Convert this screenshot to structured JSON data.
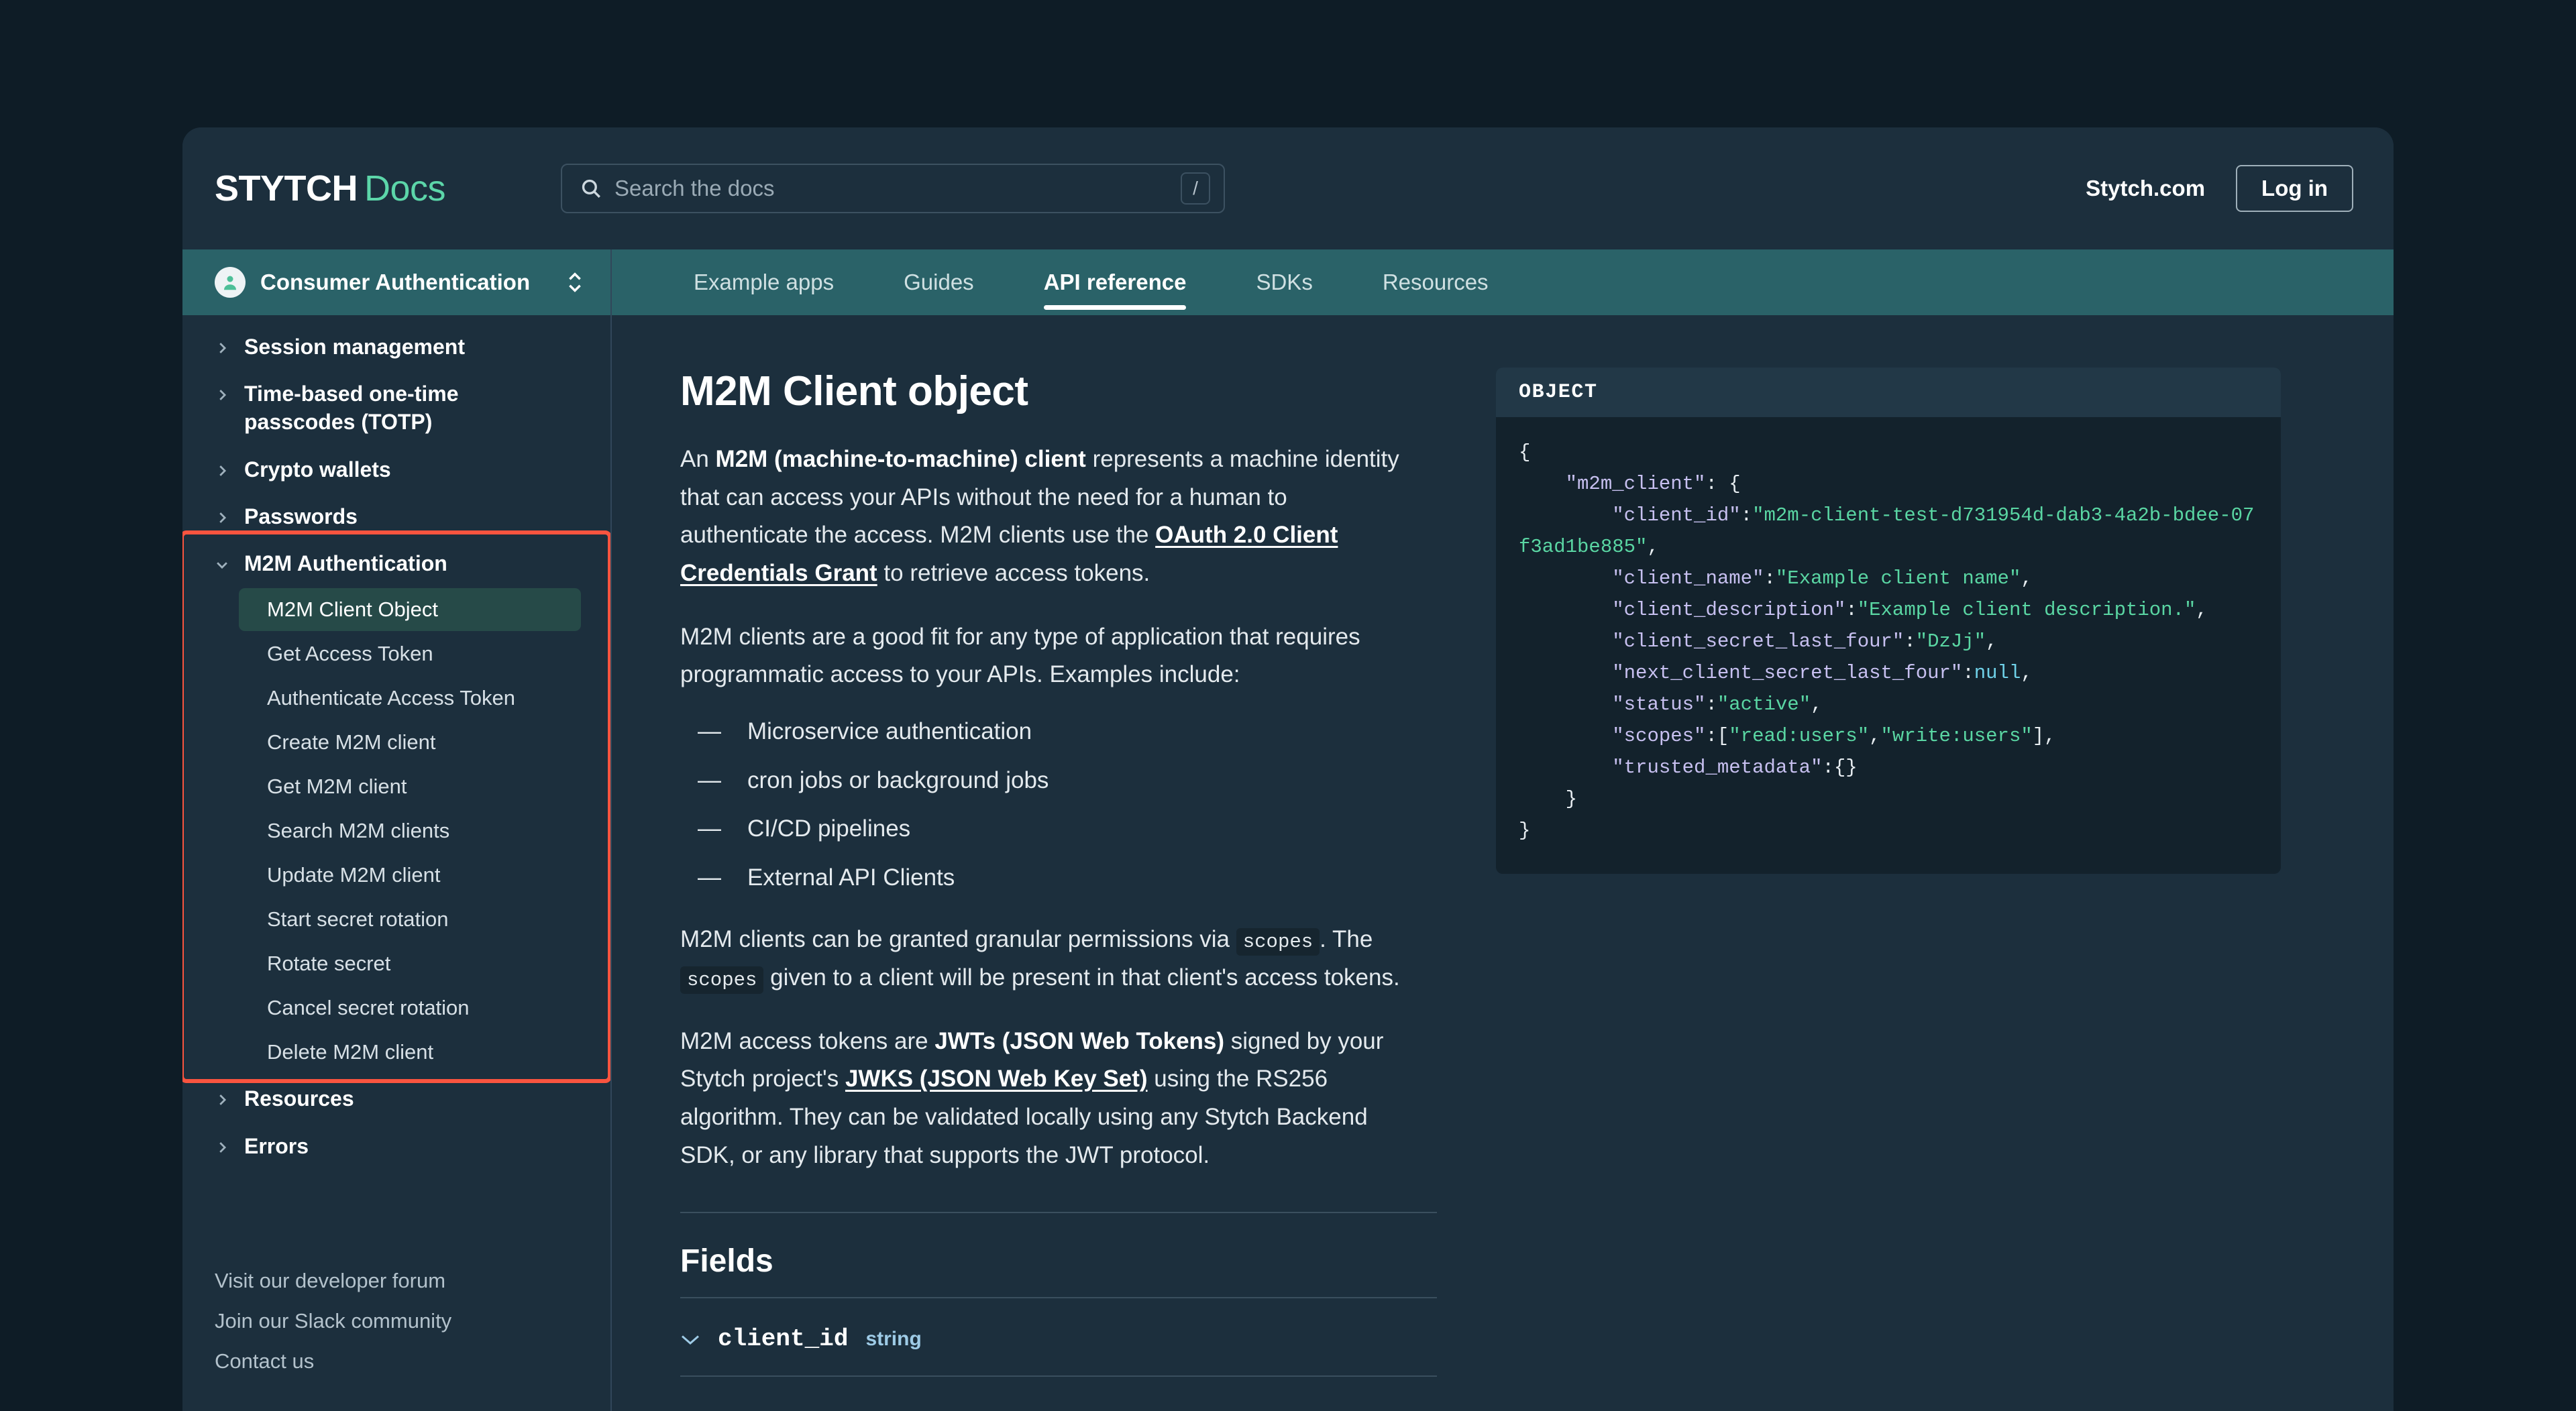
{
  "header": {
    "logo_primary": "STYTCH",
    "logo_secondary": "Docs",
    "stytch_com_link": "Stytch.com",
    "login_button": "Log in"
  },
  "search": {
    "placeholder": "Search the docs",
    "shortcut_key": "/"
  },
  "sidebar": {
    "product_selector": "Consumer Authentication",
    "groups": [
      {
        "label": "Session management",
        "expanded": false
      },
      {
        "label": "Time-based one-time passcodes (TOTP)",
        "expanded": false
      },
      {
        "label": "Crypto wallets",
        "expanded": false
      },
      {
        "label": "Passwords",
        "expanded": false
      },
      {
        "label": "M2M Authentication",
        "expanded": true
      },
      {
        "label": "Resources",
        "expanded": false
      },
      {
        "label": "Errors",
        "expanded": false
      }
    ],
    "m2m_items": [
      {
        "label": "M2M Client Object",
        "active": true
      },
      {
        "label": "Get Access Token",
        "active": false
      },
      {
        "label": "Authenticate Access Token",
        "active": false
      },
      {
        "label": "Create M2M client",
        "active": false
      },
      {
        "label": "Get M2M client",
        "active": false
      },
      {
        "label": "Search M2M clients",
        "active": false
      },
      {
        "label": "Update M2M client",
        "active": false
      },
      {
        "label": "Start secret rotation",
        "active": false
      },
      {
        "label": "Rotate secret",
        "active": false
      },
      {
        "label": "Cancel secret rotation",
        "active": false
      },
      {
        "label": "Delete M2M client",
        "active": false
      }
    ],
    "footer_links": [
      "Visit our developer forum",
      "Join our Slack community",
      "Contact us"
    ]
  },
  "tabs": [
    {
      "label": "Example apps",
      "active": false
    },
    {
      "label": "Guides",
      "active": false
    },
    {
      "label": "API reference",
      "active": true
    },
    {
      "label": "SDKs",
      "active": false
    },
    {
      "label": "Resources",
      "active": false
    }
  ],
  "main": {
    "page_title": "M2M Client object",
    "paragraph1": {
      "lead": "An ",
      "bold1": "M2M (machine-to-machine) client",
      "mid": " represents a machine identity that can access your APIs without the need for a human to authenticate the access. M2M clients use the ",
      "link1": "OAuth 2.0 Client Credentials Grant",
      "tail": " to retrieve access tokens."
    },
    "paragraph2": "M2M clients are a good fit for any type of application that requires programmatic access to your APIs. Examples include:",
    "bullets": [
      "Microservice authentication",
      "cron jobs or background jobs",
      "CI/CD pipelines",
      "External API Clients"
    ],
    "bullet_marker": "—",
    "paragraph3": {
      "part1": "M2M clients can be granted granular permissions via ",
      "code1": "scopes",
      "part2": ". The ",
      "code2": "scopes",
      "part3": " given to a client will be present in that client's access tokens."
    },
    "paragraph4": {
      "part1": "M2M access tokens are ",
      "bold1": "JWTs (JSON Web Tokens)",
      "part2": " signed by your Stytch project's ",
      "link1": "JWKS (JSON Web Key Set)",
      "part3": " using the RS256 algorithm. They can be validated locally using any Stytch Backend SDK, or any library that supports the JWT protocol."
    },
    "fields_title": "Fields",
    "fields": [
      {
        "name": "client_id",
        "type": "string"
      }
    ]
  },
  "code_panel": {
    "header": "OBJECT",
    "lines": [
      {
        "text": "{",
        "cls": "p"
      },
      {
        "text": "    \"m2m_client\": {",
        "cls": "k"
      },
      {
        "text": "        \"client_id\":\"m2m-client-test-d731954d-dab3-4a2b-bdee-07f3ad1be885\",",
        "cls": "mix"
      },
      {
        "text": "        \"client_name\":\"Example client name\",",
        "cls": "mix"
      },
      {
        "text": "        \"client_description\":\"Example client description.\",",
        "cls": "mix"
      },
      {
        "text": "        \"client_secret_last_four\":\"DzJj\",",
        "cls": "mix"
      },
      {
        "text": "        \"next_client_secret_last_four\":null,",
        "cls": "mix"
      },
      {
        "text": "        \"status\":\"active\",",
        "cls": "mix"
      },
      {
        "text": "        \"scopes\":[\"read:users\",\"write:users\"],",
        "cls": "mix"
      },
      {
        "text": "        \"trusted_metadata\":{}",
        "cls": "mix"
      },
      {
        "text": "    }",
        "cls": "p"
      },
      {
        "text": "}",
        "cls": "p"
      }
    ],
    "json": {
      "m2m_client": {
        "client_id": "m2m-client-test-d731954d-dab3-4a2b-bdee-07f3ad1be885",
        "client_name": "Example client name",
        "client_description": "Example client description.",
        "client_secret_last_four": "DzJj",
        "next_client_secret_last_four": null,
        "status": "active",
        "scopes": [
          "read:users",
          "write:users"
        ],
        "trusted_metadata": {}
      }
    }
  },
  "annotation": {
    "highlight_color": "#f9543f",
    "target": "M2M Authentication"
  },
  "colors": {
    "page_background": "#0e1c26",
    "panel": "#1c2f3d",
    "teal_bar": "#2a6268",
    "accent_green": "#5cd6a9",
    "code_background": "#13222c"
  }
}
